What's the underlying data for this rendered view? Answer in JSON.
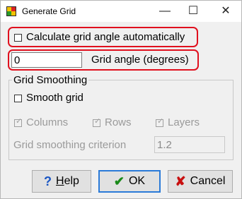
{
  "window": {
    "title": "Generate Grid",
    "icon": "grid-app-icon"
  },
  "titlebar_buttons": {
    "minimize": "—",
    "maximize": "☐",
    "close": "✕"
  },
  "auto_angle": {
    "label": "Calculate grid angle automatically",
    "checked": false
  },
  "grid_angle": {
    "value": "0",
    "label": "Grid angle (degrees)"
  },
  "smoothing": {
    "group_title": "Grid Smoothing",
    "smooth_label": "Smooth grid",
    "smooth_checked": false,
    "columns_label": "Columns",
    "rows_label": "Rows",
    "layers_label": "Layers",
    "criterion_label": "Grid smoothing criterion",
    "criterion_value": "1.2"
  },
  "buttons": {
    "help": "Help",
    "ok": "OK",
    "cancel": "Cancel"
  },
  "colors": {
    "highlight": "#e0101e",
    "help_icon": "#1a56c4",
    "ok_icon": "#1a8a1a",
    "cancel_icon": "#c81010"
  }
}
